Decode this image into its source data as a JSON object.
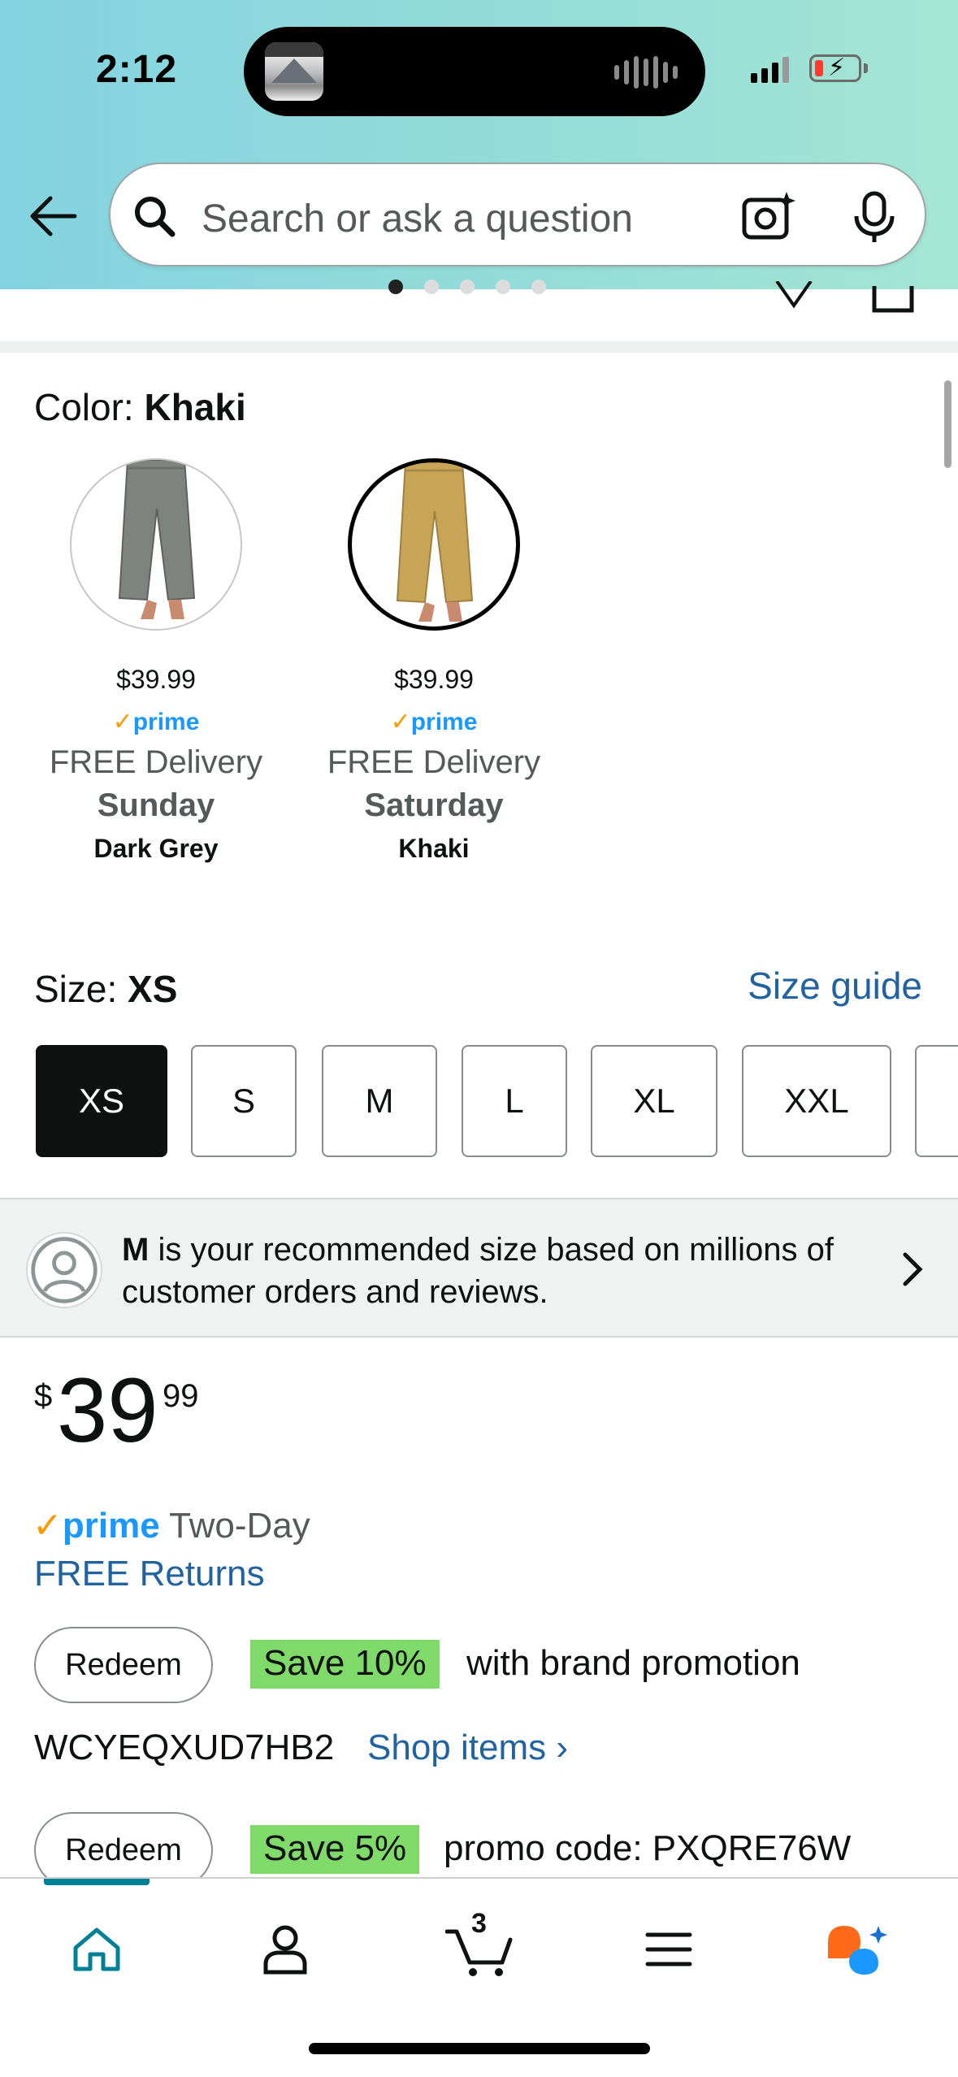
{
  "status_bar": {
    "time": "2:12"
  },
  "search": {
    "placeholder": "Search or ask a question"
  },
  "color": {
    "label": "Color: ",
    "selected": "Khaki",
    "options": [
      {
        "name": "Dark Grey",
        "price": "$39.99",
        "prime": "prime",
        "delivery": "FREE Delivery",
        "day": "Sunday",
        "swatch_color": "#7f8380"
      },
      {
        "name": "Khaki",
        "price": "$39.99",
        "prime": "prime",
        "delivery": "FREE Delivery",
        "day": "Saturday",
        "swatch_color": "#c7a456"
      }
    ]
  },
  "size": {
    "label": "Size: ",
    "selected": "XS",
    "guide_link": "Size guide",
    "options": [
      "XS",
      "S",
      "M",
      "L",
      "XL",
      "XXL"
    ]
  },
  "recommendation": {
    "size": "M",
    "text": " is your recommended size based on millions of customer orders and reviews."
  },
  "price": {
    "symbol": "$",
    "whole": "39",
    "fraction": "99"
  },
  "shipping": {
    "prime_label": "prime",
    "two_day": " Two-Day",
    "returns": "FREE Returns"
  },
  "promotions": [
    {
      "button": "Redeem",
      "badge": "Save 10%",
      "text": "with brand promotion",
      "code": "WCYEQXUD7HB2",
      "link": "Shop items ›"
    },
    {
      "button": "Redeem",
      "badge": "Save 5%",
      "text": "promo code: PXQRE76W"
    }
  ],
  "tabbar": {
    "cart_count": "3",
    "active_tab": "home",
    "accent_color": "#008296"
  },
  "colors": {
    "link": "#2162a1",
    "prime_blue": "#1a98ff",
    "prime_check": "#ff9900",
    "save_green": "#7fda69"
  }
}
